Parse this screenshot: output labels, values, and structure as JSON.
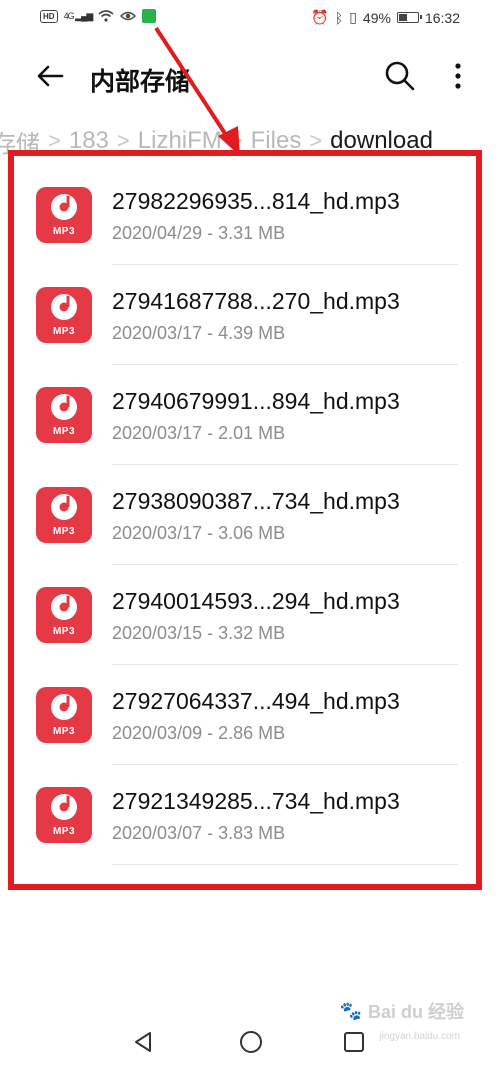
{
  "status_bar": {
    "hd_badge": "HD",
    "signal": "4G",
    "battery_percent": "49%",
    "battery_level": 0.49,
    "time": "16:32"
  },
  "app_bar": {
    "title": "内部存储",
    "back_icon": "arrow-left-icon",
    "search_icon": "search-icon",
    "more_icon": "more-vertical-icon"
  },
  "breadcrumb": [
    "存储",
    "183",
    "LizhiFM",
    "Files",
    "download"
  ],
  "files": [
    {
      "name": "27982296935...814_hd.mp3",
      "info": "2020/04/29 - 3.31 MB",
      "icon_label": "MP3"
    },
    {
      "name": "27941687788...270_hd.mp3",
      "info": "2020/03/17 - 4.39 MB",
      "icon_label": "MP3"
    },
    {
      "name": "27940679991...894_hd.mp3",
      "info": "2020/03/17 - 2.01 MB",
      "icon_label": "MP3"
    },
    {
      "name": "27938090387...734_hd.mp3",
      "info": "2020/03/17 - 3.06 MB",
      "icon_label": "MP3"
    },
    {
      "name": "27940014593...294_hd.mp3",
      "info": "2020/03/15 - 3.32 MB",
      "icon_label": "MP3"
    },
    {
      "name": "27927064337...494_hd.mp3",
      "info": "2020/03/09 - 2.86 MB",
      "icon_label": "MP3"
    },
    {
      "name": "27921349285...734_hd.mp3",
      "info": "2020/03/07 - 3.83 MB",
      "icon_label": "MP3"
    }
  ],
  "nav_bar": {
    "back_icon": "triangle-back-icon",
    "home_icon": "circle-home-icon",
    "recents_icon": "square-recents-icon"
  },
  "watermark": {
    "text": "Bai du 经验",
    "sub": "jingyan.baidu.com"
  },
  "colors": {
    "accent_red": "#e11b22",
    "file_icon_red": "#e63946"
  }
}
